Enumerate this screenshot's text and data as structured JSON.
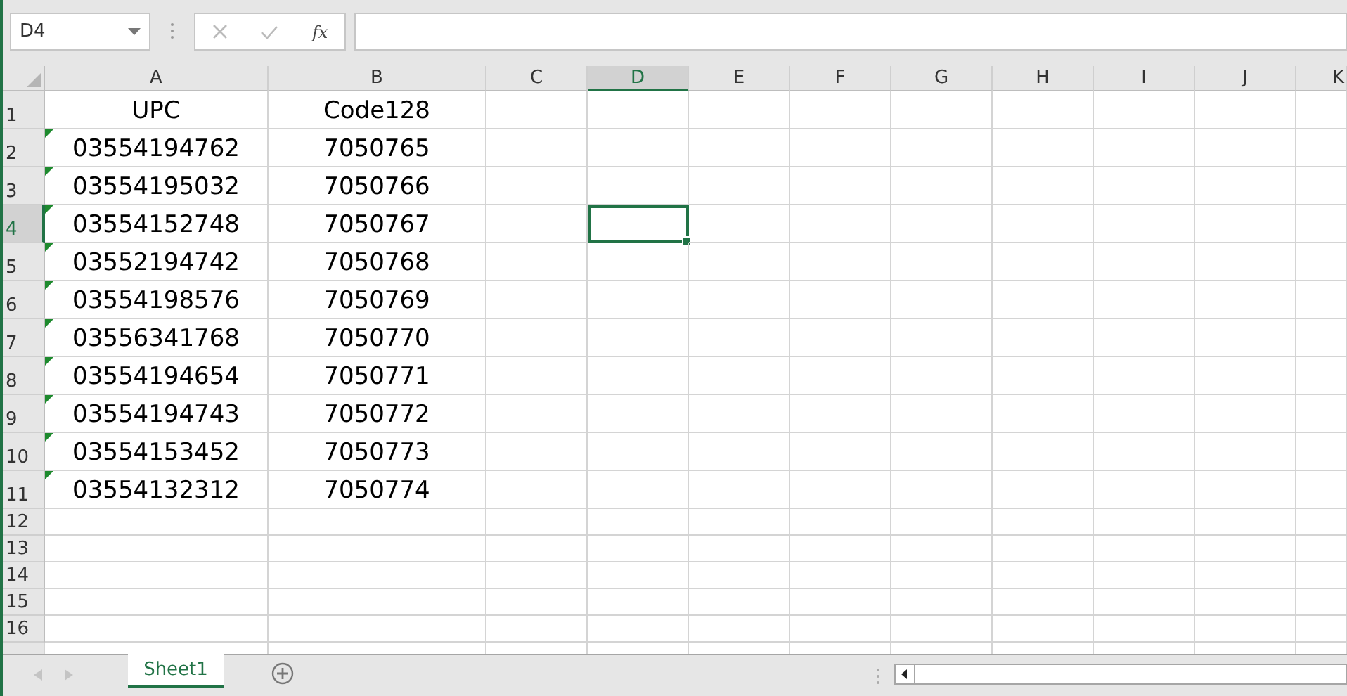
{
  "name_box": "D4",
  "formula_bar": {
    "function_label": "fx"
  },
  "columns": [
    {
      "label": "A",
      "selected": false
    },
    {
      "label": "B",
      "selected": false
    },
    {
      "label": "C",
      "selected": false
    },
    {
      "label": "D",
      "selected": true
    },
    {
      "label": "E",
      "selected": false
    },
    {
      "label": "F",
      "selected": false
    },
    {
      "label": "G",
      "selected": false
    },
    {
      "label": "H",
      "selected": false
    },
    {
      "label": "I",
      "selected": false
    },
    {
      "label": "J",
      "selected": false
    },
    {
      "label": "K",
      "selected": false
    }
  ],
  "rows": [
    {
      "label": "1",
      "selected": false,
      "cells": [
        {
          "value": "UPC",
          "text_flag": false
        },
        {
          "value": "Code128",
          "text_flag": false
        }
      ]
    },
    {
      "label": "2",
      "selected": false,
      "cells": [
        {
          "value": "03554194762",
          "text_flag": true
        },
        {
          "value": "7050765",
          "text_flag": false
        }
      ]
    },
    {
      "label": "3",
      "selected": false,
      "cells": [
        {
          "value": "03554195032",
          "text_flag": true
        },
        {
          "value": "7050766",
          "text_flag": false
        }
      ]
    },
    {
      "label": "4",
      "selected": true,
      "cells": [
        {
          "value": "03554152748",
          "text_flag": true
        },
        {
          "value": "7050767",
          "text_flag": false
        }
      ]
    },
    {
      "label": "5",
      "selected": false,
      "cells": [
        {
          "value": "03552194742",
          "text_flag": true
        },
        {
          "value": "7050768",
          "text_flag": false
        }
      ]
    },
    {
      "label": "6",
      "selected": false,
      "cells": [
        {
          "value": "03554198576",
          "text_flag": true
        },
        {
          "value": "7050769",
          "text_flag": false
        }
      ]
    },
    {
      "label": "7",
      "selected": false,
      "cells": [
        {
          "value": "03556341768",
          "text_flag": true
        },
        {
          "value": "7050770",
          "text_flag": false
        }
      ]
    },
    {
      "label": "8",
      "selected": false,
      "cells": [
        {
          "value": "03554194654",
          "text_flag": true
        },
        {
          "value": "7050771",
          "text_flag": false
        }
      ]
    },
    {
      "label": "9",
      "selected": false,
      "cells": [
        {
          "value": "03554194743",
          "text_flag": true
        },
        {
          "value": "7050772",
          "text_flag": false
        }
      ]
    },
    {
      "label": "10",
      "selected": false,
      "cells": [
        {
          "value": "03554153452",
          "text_flag": true
        },
        {
          "value": "7050773",
          "text_flag": false
        }
      ]
    },
    {
      "label": "11",
      "selected": false,
      "cells": [
        {
          "value": "03554132312",
          "text_flag": true
        },
        {
          "value": "7050774",
          "text_flag": false
        }
      ]
    },
    {
      "label": "12",
      "selected": false,
      "cells": []
    },
    {
      "label": "13",
      "selected": false,
      "cells": []
    },
    {
      "label": "14",
      "selected": false,
      "cells": []
    },
    {
      "label": "15",
      "selected": false,
      "cells": []
    },
    {
      "label": "16",
      "selected": false,
      "cells": []
    }
  ],
  "sheet_tabs": [
    {
      "label": "Sheet1",
      "selected": true
    }
  ]
}
